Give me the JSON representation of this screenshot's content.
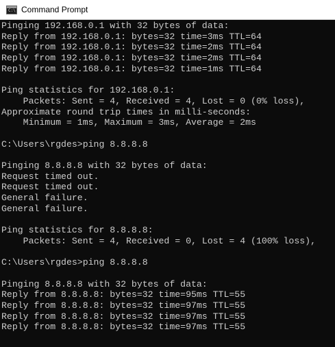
{
  "window": {
    "title": "Command Prompt",
    "icon": "command-prompt-icon"
  },
  "console": {
    "lines": [
      "Pinging 192.168.0.1 with 32 bytes of data:",
      "Reply from 192.168.0.1: bytes=32 time=3ms TTL=64",
      "Reply from 192.168.0.1: bytes=32 time=2ms TTL=64",
      "Reply from 192.168.0.1: bytes=32 time=2ms TTL=64",
      "Reply from 192.168.0.1: bytes=32 time=1ms TTL=64",
      "",
      "Ping statistics for 192.168.0.1:",
      "    Packets: Sent = 4, Received = 4, Lost = 0 (0% loss),",
      "Approximate round trip times in milli-seconds:",
      "    Minimum = 1ms, Maximum = 3ms, Average = 2ms",
      "",
      "C:\\Users\\rgdes>ping 8.8.8.8",
      "",
      "Pinging 8.8.8.8 with 32 bytes of data:",
      "Request timed out.",
      "Request timed out.",
      "General failure.",
      "General failure.",
      "",
      "Ping statistics for 8.8.8.8:",
      "    Packets: Sent = 4, Received = 0, Lost = 4 (100% loss),",
      "",
      "C:\\Users\\rgdes>ping 8.8.8.8",
      "",
      "Pinging 8.8.8.8 with 32 bytes of data:",
      "Reply from 8.8.8.8: bytes=32 time=95ms TTL=55",
      "Reply from 8.8.8.8: bytes=32 time=97ms TTL=55",
      "Reply from 8.8.8.8: bytes=32 time=97ms TTL=55",
      "Reply from 8.8.8.8: bytes=32 time=97ms TTL=55"
    ]
  },
  "colors": {
    "background": "#0c0c0c",
    "text": "#cccccc",
    "titlebar": "#ffffff"
  }
}
